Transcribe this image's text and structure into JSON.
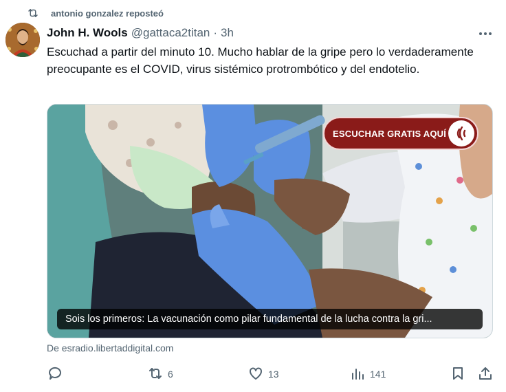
{
  "repost": {
    "label": "antonio gonzalez reposteó",
    "icon": "repost-icon"
  },
  "tweet": {
    "author_name": "John H. Wools",
    "author_handle": "@gattaca2titan",
    "separator": "·",
    "time": "3h",
    "text": "Escuchad a partir del minuto 10. Mucho hablar de la gripe pero lo verdaderamente preocupante es el COVID, virus sistémico protrombótico y del endotelio.",
    "more_icon": "more-icon"
  },
  "media": {
    "overlay_button_label": "ESCUCHAR GRATIS AQUÍ",
    "overlay_icon": "radio-logo-icon",
    "caption": "Sois los primeros: La vacunación como pilar fundamental de la lucha contra la gri..."
  },
  "source": {
    "label": "De esradio.libertaddigital.com"
  },
  "actions": {
    "reply": {
      "icon": "reply-icon",
      "count": ""
    },
    "retweet": {
      "icon": "retweet-icon",
      "count": "6"
    },
    "like": {
      "icon": "heart-icon",
      "count": "13"
    },
    "views": {
      "icon": "views-icon",
      "count": "141"
    },
    "bookmark": {
      "icon": "bookmark-icon"
    },
    "share": {
      "icon": "share-icon"
    }
  },
  "colors": {
    "text_primary": "#0f1419",
    "text_secondary": "#536471",
    "overlay_button": "#8a1b19"
  }
}
